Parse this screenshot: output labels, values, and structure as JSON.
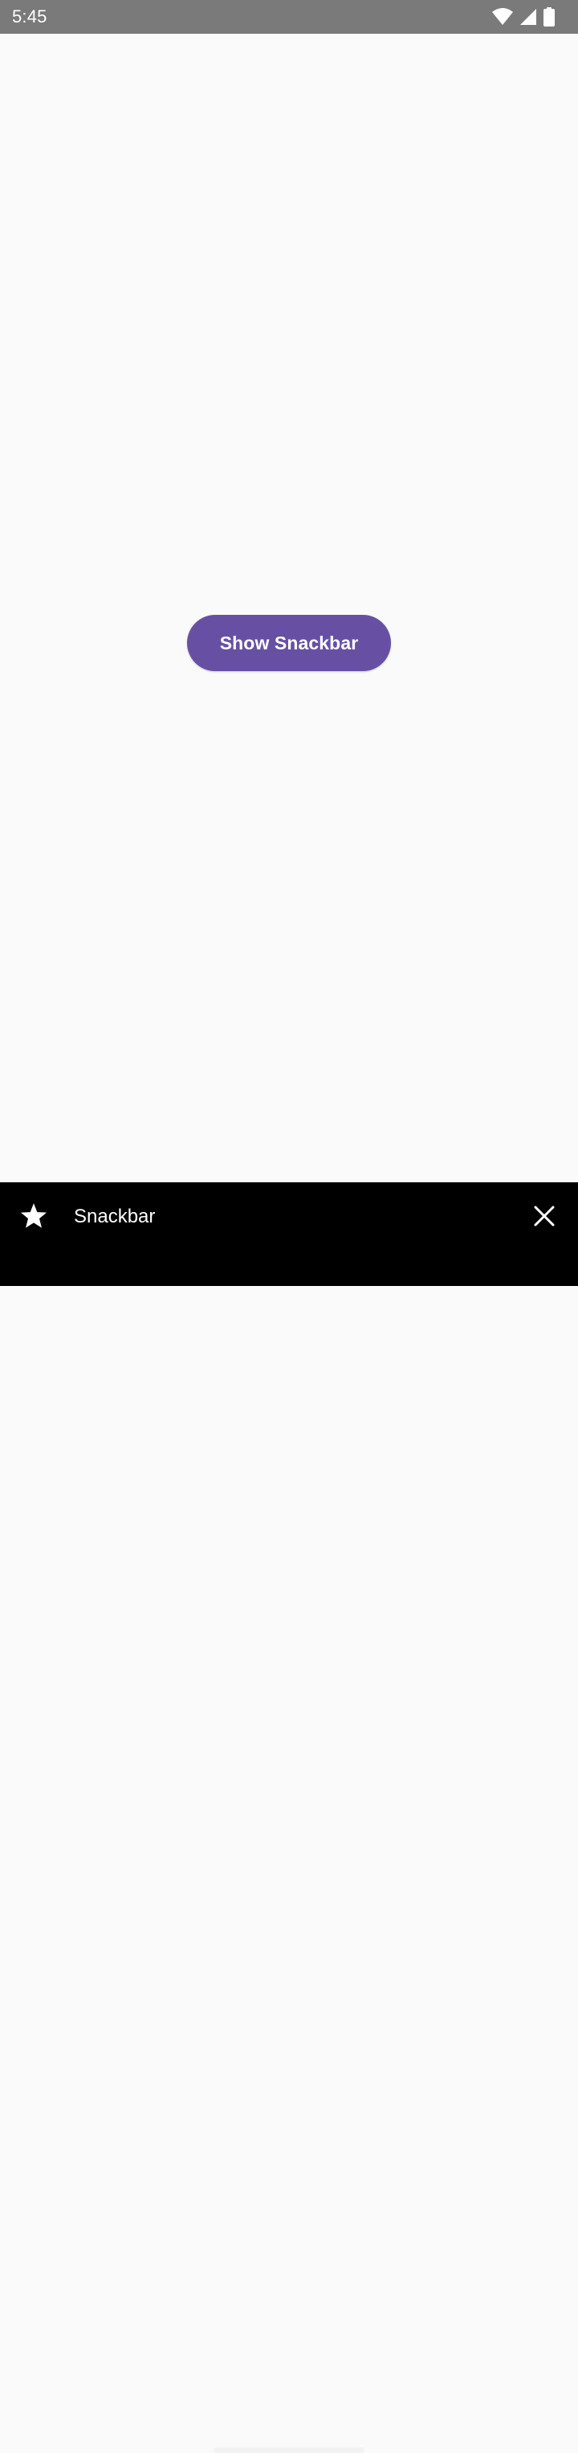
{
  "status_bar": {
    "time": "5:45",
    "icons": [
      "wifi-icon",
      "cellular-signal-icon",
      "battery-icon"
    ],
    "background": "#7a7a7a"
  },
  "main": {
    "show_snackbar_label": "Show Snackbar",
    "button_color": "#6750a4",
    "background": "#fafafa"
  },
  "snackbar": {
    "icon": "star-icon",
    "message": "Snackbar",
    "dismiss_icon": "close-icon",
    "background": "#000000"
  }
}
